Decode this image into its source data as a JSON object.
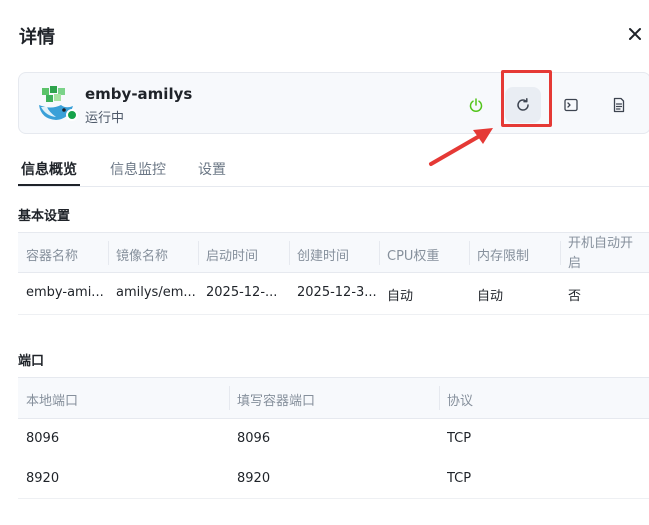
{
  "dialog": {
    "title": "详情",
    "close_icon": "close-icon"
  },
  "container": {
    "name": "emby-amilys",
    "status": "运行中",
    "status_color": "#16a34a",
    "avatar_icon": "emby-whale-logo",
    "actions": [
      {
        "icon": "power-icon",
        "color": "#52c41a"
      },
      {
        "icon": "restart-icon",
        "highlighted": true
      },
      {
        "icon": "terminal-icon"
      },
      {
        "icon": "document-icon"
      }
    ]
  },
  "annotation": {
    "highlight_color": "#e53935"
  },
  "tabs": [
    {
      "label": "信息概览",
      "active": true
    },
    {
      "label": "信息监控",
      "active": false
    },
    {
      "label": "设置",
      "active": false
    }
  ],
  "basic": {
    "heading": "基本设置",
    "columns": [
      "容器名称",
      "镜像名称",
      "启动时间",
      "创建时间",
      "CPU权重",
      "内存限制",
      "开机自动开启"
    ],
    "row": [
      "emby-ami...",
      "amilys/em...",
      "2025-12-...",
      "2025-12-3...",
      "自动",
      "自动",
      "否"
    ]
  },
  "ports": {
    "heading": "端口",
    "columns": [
      "本地端口",
      "填写容器端口",
      "协议"
    ],
    "rows": [
      [
        "8096",
        "8096",
        "TCP"
      ],
      [
        "8920",
        "8920",
        "TCP"
      ]
    ]
  }
}
